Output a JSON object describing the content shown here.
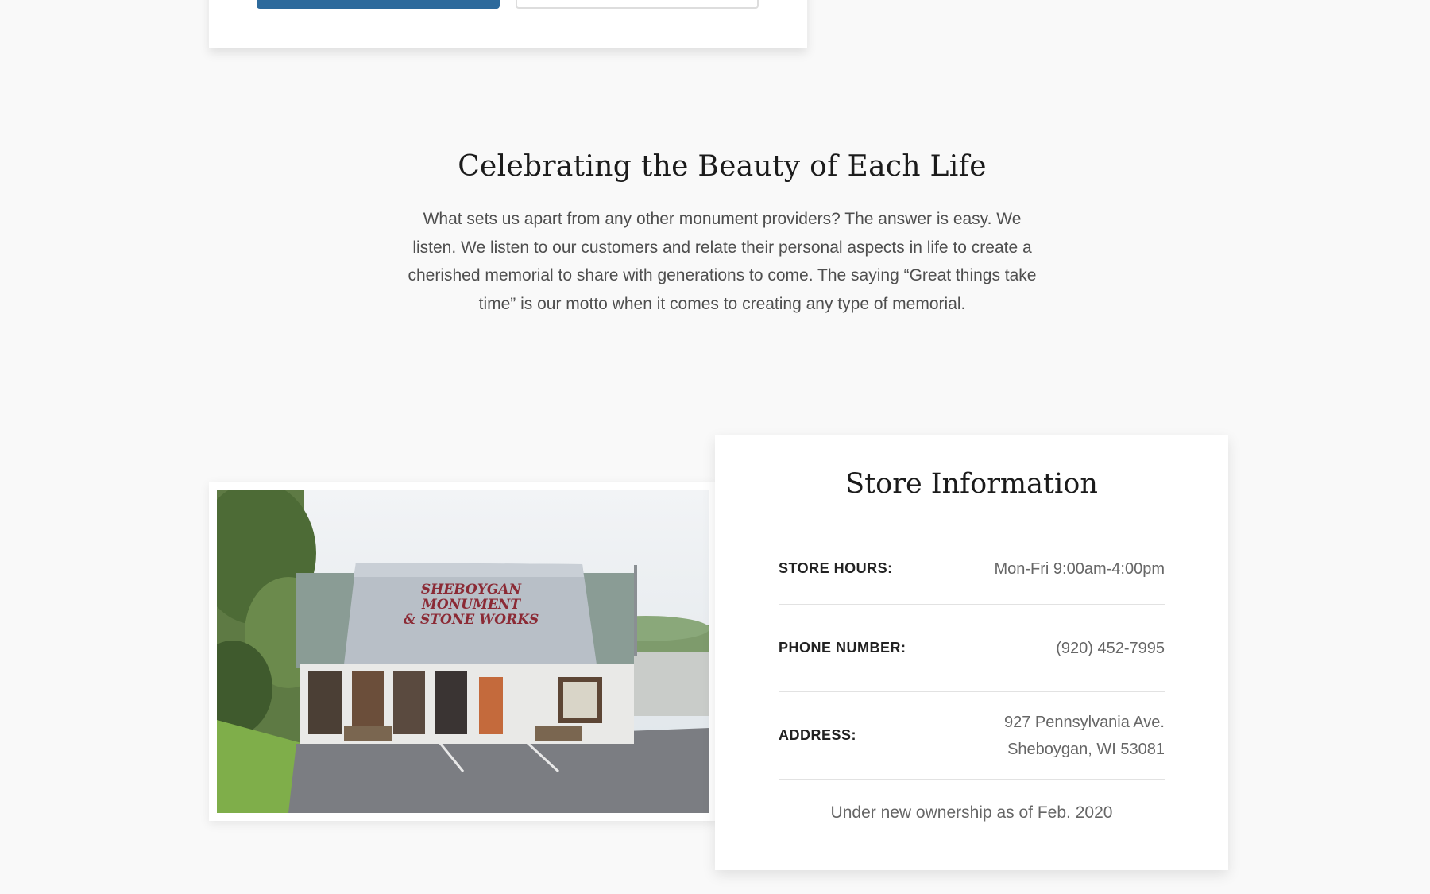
{
  "intro": {
    "heading": "Celebrating the Beauty of Each Life",
    "body": "What sets us apart from any other monument providers? The answer is easy. We listen. We listen to our customers and relate their personal aspects in life to create a cherished memorial to share with generations to come. The saying “Great things take time” is our motto when it comes to creating any type of memorial."
  },
  "store_photo": {
    "sign_line1": "SHEBOYGAN",
    "sign_line2": "MONUMENT",
    "sign_line3": "& STONE WORKS"
  },
  "store_info": {
    "title": "Store Information",
    "hours_label": "STORE HOURS:",
    "hours_value": "Mon-Fri 9:00am-4:00pm",
    "phone_label": "PHONE NUMBER:",
    "phone_value": "(920) 452-7995",
    "address_label": "ADDRESS:",
    "address_line1": "927 Pennsylvania Ave.",
    "address_line2": "Sheboygan, WI 53081",
    "ownership_note": "Under new ownership as of Feb. 2020"
  },
  "colors": {
    "primary_button": "#2d6a9c",
    "page_background": "#f9f9f9",
    "card_background": "#ffffff"
  }
}
